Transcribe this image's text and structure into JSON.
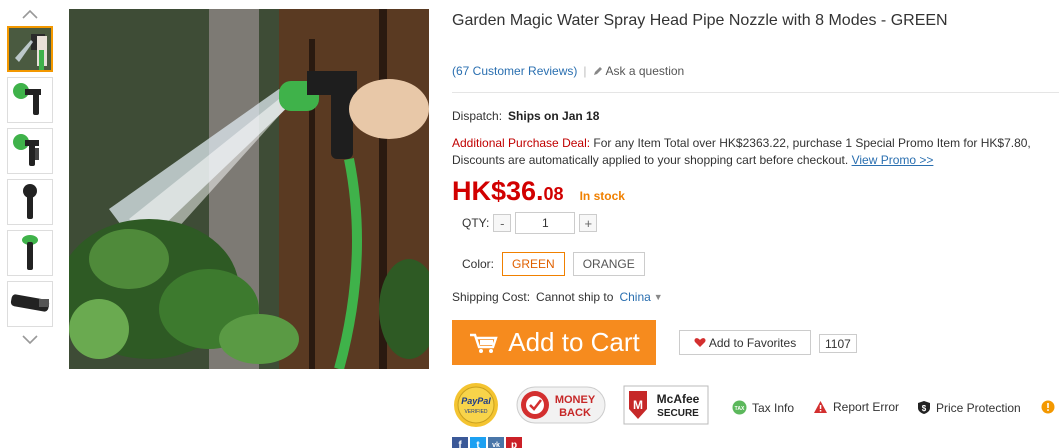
{
  "gallery": {
    "thumbnails": [
      "hose-sprayer",
      "nozzle-green",
      "nozzle-side",
      "nozzle-front",
      "nozzle-top",
      "hose-coil"
    ],
    "active_index": 0
  },
  "product": {
    "title": "Garden Magic Water Spray Head Pipe Nozzle with 8 Modes  -  GREEN",
    "reviews_link": "(67 Customer Reviews)",
    "separator": "|",
    "ask_question": "Ask a question",
    "dispatch_label": "Dispatch:",
    "dispatch_value": "Ships on Jan 18",
    "deal_label": "Additional Purchase Deal:",
    "deal_text": " For any Item Total over HK$2363.22, purchase 1 Special Promo Item for HK$7.80, Discounts are automatically applied to your shopping cart before checkout. ",
    "deal_link": "View Promo >>",
    "price_main": "HK$36.",
    "price_cents": "08",
    "stock_status": "In stock",
    "qty_label": "QTY:",
    "qty_minus": "-",
    "qty_plus": "+",
    "qty_value": "1",
    "color_label": "Color:",
    "colors": [
      "GREEN",
      "ORANGE"
    ],
    "selected_color": "GREEN",
    "shipping_label": "Shipping Cost:",
    "shipping_value": "Cannot ship to",
    "shipping_country": "China",
    "add_to_cart": "Add to Cart",
    "add_to_favorites": "Add to Favorites",
    "favorites_count": "1107"
  },
  "badges": {
    "paypal_top": "PayPal",
    "paypal_bottom": "VERIFIED",
    "money_back_top": "MONEY",
    "money_back_bottom": "BACK",
    "mcafee_top": "McAfee",
    "mcafee_bottom": "SECURE"
  },
  "services": {
    "tax_icon_text": "TAX",
    "tax_info": "Tax Info",
    "report_error": "Report Error",
    "price_protection": "Price Protection",
    "price_protection_icon_text": "$"
  },
  "social": [
    "f",
    "t",
    "vk",
    "p"
  ],
  "colors": {
    "accent_orange": "#f68b1e",
    "price_red": "#d10000",
    "link_blue": "#2a6fb0",
    "deal_red": "#c00000"
  }
}
